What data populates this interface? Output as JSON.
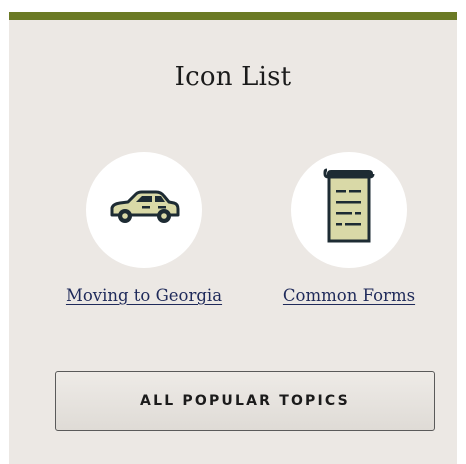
{
  "section": {
    "title": "Icon List"
  },
  "icons": [
    {
      "label": "Moving to Georgia",
      "icon": "car-icon"
    },
    {
      "label": "Common Forms",
      "icon": "document-icon"
    }
  ],
  "buttons": {
    "all_topics_label": "ALL POPULAR TOPICS"
  },
  "colors": {
    "accent_bar": "#6b7a25",
    "panel_bg": "#ece8e4",
    "icon_fill": "#d9d9a7",
    "icon_outline": "#1d2b33",
    "link_text": "#1f2a5a"
  }
}
